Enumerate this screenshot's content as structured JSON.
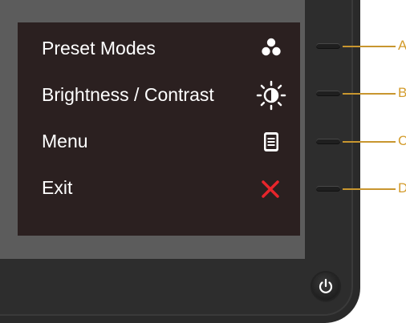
{
  "osd": {
    "items": [
      {
        "label": "Preset Modes",
        "icon": "preset-modes-icon"
      },
      {
        "label": "Brightness / Contrast",
        "icon": "brightness-contrast-icon"
      },
      {
        "label": "Menu",
        "icon": "menu-icon"
      },
      {
        "label": "Exit",
        "icon": "exit-icon"
      }
    ]
  },
  "buttons": {
    "callouts": [
      "A",
      "B",
      "C",
      "D"
    ]
  },
  "power": {
    "icon": "power-icon"
  },
  "colors": {
    "osd_background": "#2b2020",
    "text": "#ffffff",
    "exit_red": "#e8252b",
    "callout": "#d39b2a"
  }
}
